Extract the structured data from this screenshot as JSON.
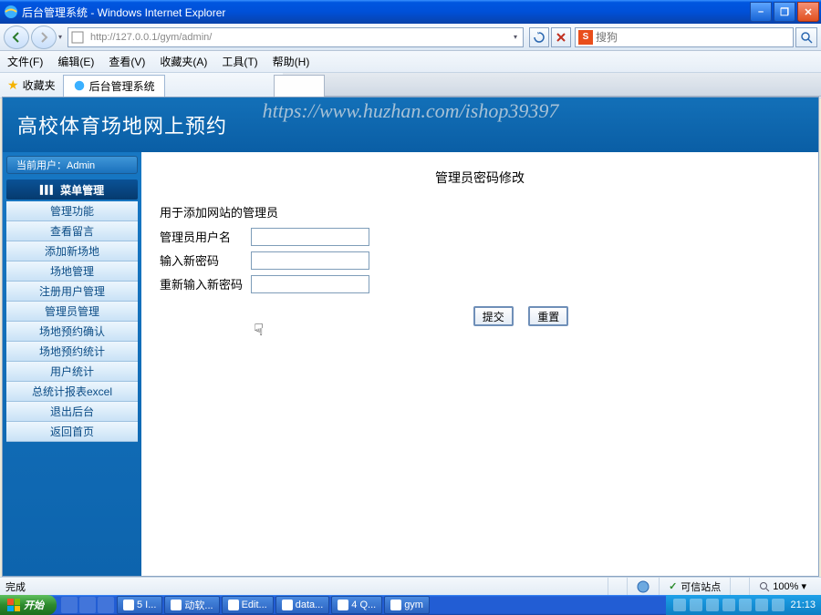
{
  "window": {
    "title": "后台管理系统 - Windows Internet Explorer"
  },
  "address": {
    "url": "http://127.0.0.1/gym/admin/"
  },
  "search": {
    "placeholder": "搜狗"
  },
  "menu": {
    "file": "文件(F)",
    "edit": "编辑(E)",
    "view": "查看(V)",
    "favorites": "收藏夹(A)",
    "tools": "工具(T)",
    "help": "帮助(H)"
  },
  "favbar": {
    "label": "收藏夹",
    "tab": "后台管理系统"
  },
  "watermark": "https://www.huzhan.com/ishop39397",
  "banner": "高校体育场地网上预约",
  "user_label": "当前用户：Admin",
  "menu_header": "菜单管理",
  "sidebar": {
    "items": [
      "管理功能",
      "查看留言",
      "添加新场地",
      "场地管理",
      "注册用户管理",
      "管理员管理",
      "场地预约确认",
      "场地预约统计",
      "用户统计",
      "总统计报表excel",
      "退出后台",
      "返回首页"
    ]
  },
  "form": {
    "title": "管理员密码修改",
    "desc": "用于添加网站的管理员",
    "username_label": "管理员用户名",
    "newpass_label": "输入新密码",
    "confirm_label": "重新输入新密码",
    "submit": "提交",
    "reset": "重置"
  },
  "status": {
    "done": "完成",
    "trusted": "可信站点",
    "zoom": "100%"
  },
  "taskbar": {
    "start": "开始",
    "buttons": [
      "5 I...",
      "动软...",
      "Edit...",
      "data...",
      "4 Q...",
      "gym"
    ],
    "clock": "21:13"
  }
}
